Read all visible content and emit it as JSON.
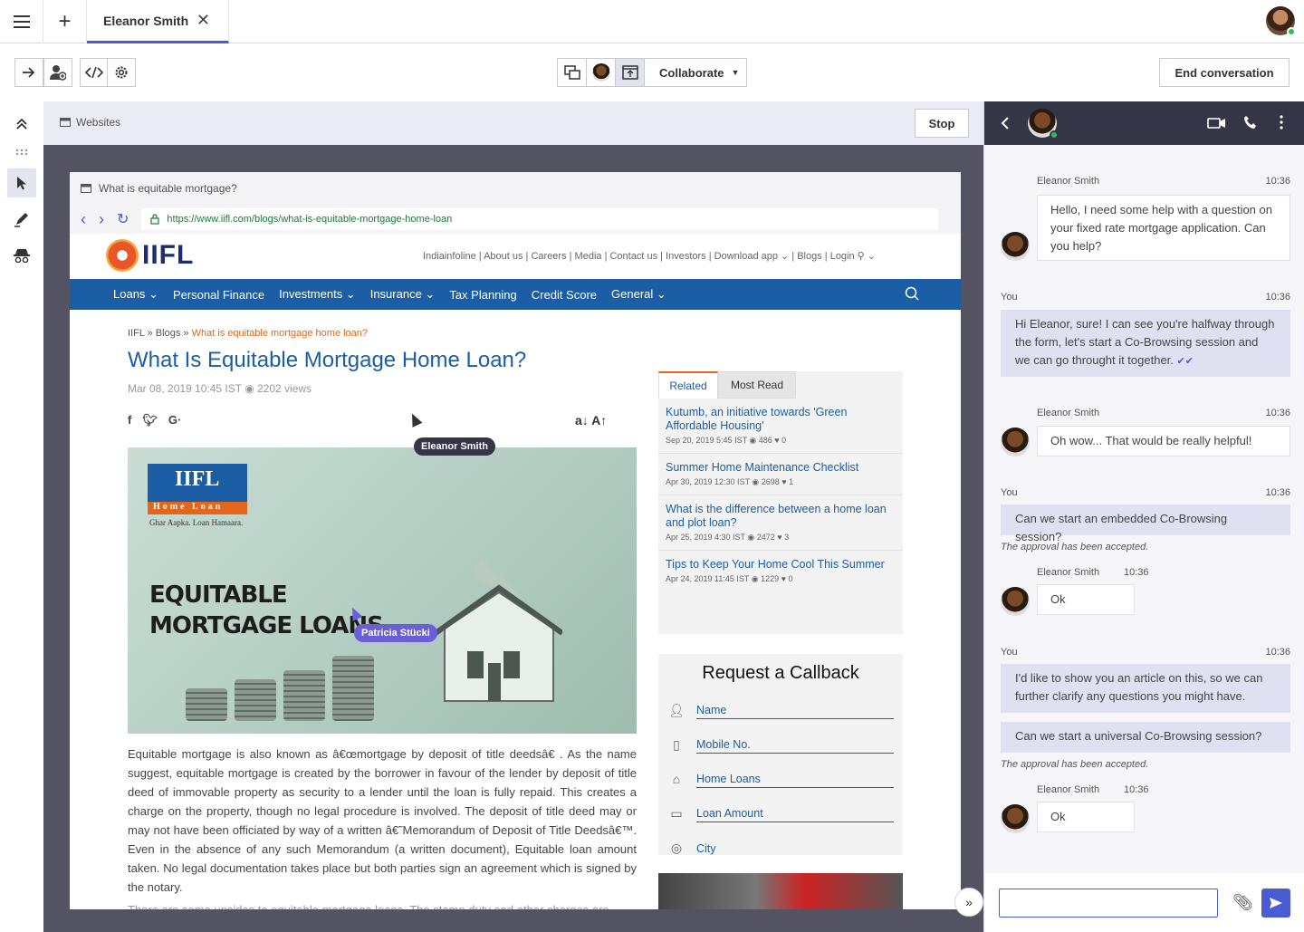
{
  "tabs": {
    "new_tab": "+",
    "active_tab": "Eleanor Smith",
    "close": "✕"
  },
  "toolbar": {
    "collaborate_label": "Collaborate",
    "end_label": "End conversation"
  },
  "websites": {
    "title": "Websites",
    "stop_label": "Stop"
  },
  "browser": {
    "window_title": "What is equitable mortgage?",
    "url": "https://www.iifl.com/blogs/what-is-equitable-mortgage-home-loan"
  },
  "site": {
    "logo_text": "IIFL",
    "top_links": "Indiainfoline | About us | Careers | Media | Contact us | Investors | Download app ⌄ | Blogs | Login ⚲ ⌄",
    "nav": [
      "Loans ⌄",
      "Personal Finance",
      "Investments ⌄",
      "Insurance ⌄",
      "Tax Planning",
      "Credit Score",
      "General ⌄"
    ],
    "breadcrumb": {
      "a": "IIFL",
      "sep": "»",
      "b": "Blogs",
      "c": "What is equitable mortgage home loan?"
    },
    "title": "What Is Equitable Mortgage Home Loan?",
    "meta": "Mar 08, 2019 10:45 IST ◉ 2202 views",
    "font_controls": "a↓  A↑",
    "hero": {
      "brand": "IIFL",
      "brand_sub": "Home Loan",
      "tagline": "Ghar Aapka. Loan Hamaara.",
      "line1": "EQUITABLE",
      "line2": "MORTGAGE LOANS"
    },
    "paragraph": "Equitable mortgage is also known as â€œmortgage by deposit of title deedsâ€  . As the name suggest, equitable mortgage is created by the borrower in favour of the lender by deposit of title deed of immovable property as security to a lender until the loan is fully repaid.  This creates a charge on the property, though no legal procedure is involved. The deposit of title deed may or may not have been officiated by way of a written â€˜Memorandum of Deposit of Title Deedsâ€™. Even in the absence of any such Memorandum (a written document), Equitable loan amount taken. No legal documentation takes place but both parties sign an agreement which is signed by the notary.",
    "paragraph2": "There are some upsides to equitable mortgage loans. The stamp duty and other charges are",
    "side_tabs": {
      "related": "Related",
      "most_read": "Most Read"
    },
    "articles": [
      {
        "title": "Kutumb, an initiative towards 'Green Affordable Housing'",
        "meta": "Sep 20, 2019 5:45 IST ◉  486  ♥  0"
      },
      {
        "title": "Summer Home Maintenance Checklist",
        "meta": "Apr 30, 2019 12:30 IST ◉  2698  ♥  1"
      },
      {
        "title": "What is the difference between a home loan and plot loan?",
        "meta": "Apr 25, 2019 4:30 IST ◉  2472  ♥  3"
      },
      {
        "title": "Tips to Keep Your Home Cool This Summer",
        "meta": "Apr 24, 2019 11:45 IST ◉  1229  ♥  0"
      }
    ],
    "callback": {
      "title": "Request a Callback",
      "fields": [
        "Name",
        "Mobile No.",
        "Home Loans",
        "Loan Amount",
        "City"
      ]
    }
  },
  "cursors": {
    "agent": "Eleanor Smith",
    "visitor": "Patricia Stücki"
  },
  "chat": {
    "messages": [
      {
        "from": "Eleanor Smith",
        "time": "10:36",
        "text": "Hello, I need some help with a question on your fixed rate mortgage application. Can you help?"
      },
      {
        "from": "You",
        "time": "10:36",
        "text": "Hi Eleanor, sure! I can see you're halfway through the form, let's start a Co-Browsing session and we can go throught it together."
      },
      {
        "from": "Eleanor Smith",
        "time": "10:36",
        "text": "Oh wow... That would be really helpful!"
      },
      {
        "from": "You",
        "time": "10:36",
        "text": "Can we start an embedded Co-Browsing session?"
      },
      {
        "system": "The approval has been accepted."
      },
      {
        "from": "Eleanor Smith",
        "time": "10:36",
        "text": "Ok"
      },
      {
        "from": "You",
        "time": "10:36",
        "text": "I'd like to show you an article on this, so we can further clarify any questions you might have."
      },
      {
        "from": "You",
        "text": "Can we start a universal Co-Browsing session?"
      },
      {
        "system": "The approval has been accepted."
      },
      {
        "from": "Eleanor Smith",
        "time": "10:36",
        "text": "Ok"
      }
    ]
  },
  "colors": {
    "accent": "#4a5bd4",
    "brand_blue": "#1c5ea6",
    "orange": "#e2661c",
    "dark_header": "#353548"
  }
}
